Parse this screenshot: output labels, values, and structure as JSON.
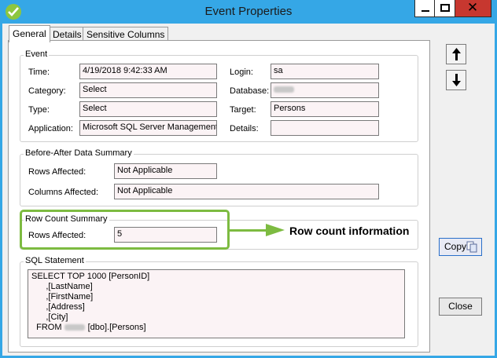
{
  "window": {
    "title": "Event Properties",
    "close_glyph": "✕"
  },
  "tabs": [
    {
      "label": "General",
      "active": true
    },
    {
      "label": "Details",
      "active": false
    },
    {
      "label": "Sensitive Columns",
      "active": false
    }
  ],
  "event": {
    "legend": "Event",
    "time_label": "Time:",
    "time_value": "4/19/2018 9:42:33 AM",
    "category_label": "Category:",
    "category_value": "Select",
    "type_label": "Type:",
    "type_value": "Select",
    "application_label": "Application:",
    "application_value": "Microsoft SQL Server Management",
    "login_label": "Login:",
    "login_value": "sa",
    "database_label": "Database:",
    "target_label": "Target:",
    "target_value": "Persons",
    "details_label": "Details:",
    "details_value": ""
  },
  "before_after": {
    "legend": "Before-After Data Summary",
    "rows_label": "Rows Affected:",
    "rows_value": "Not Applicable",
    "columns_label": "Columns Affected:",
    "columns_value": "Not Applicable"
  },
  "row_count": {
    "legend": "Row Count Summary",
    "rows_label": "Rows Affected:",
    "rows_value": "5"
  },
  "annotation": {
    "text": "Row count information",
    "color": "#7dbb41"
  },
  "sql": {
    "legend": "SQL Statement",
    "lines": [
      "SELECT TOP 1000 [PersonID]",
      "      ,[LastName]",
      "      ,[FirstName]",
      "      ,[Address]",
      "      ,[City]"
    ],
    "from_prefix": "  FROM ",
    "from_suffix": "[dbo].[Persons]"
  },
  "buttons": {
    "copy": "Copy",
    "close": "Close"
  },
  "colors": {
    "titlebar": "#35a7e6",
    "close_button": "#c7372f",
    "highlight": "#7dbb41"
  }
}
